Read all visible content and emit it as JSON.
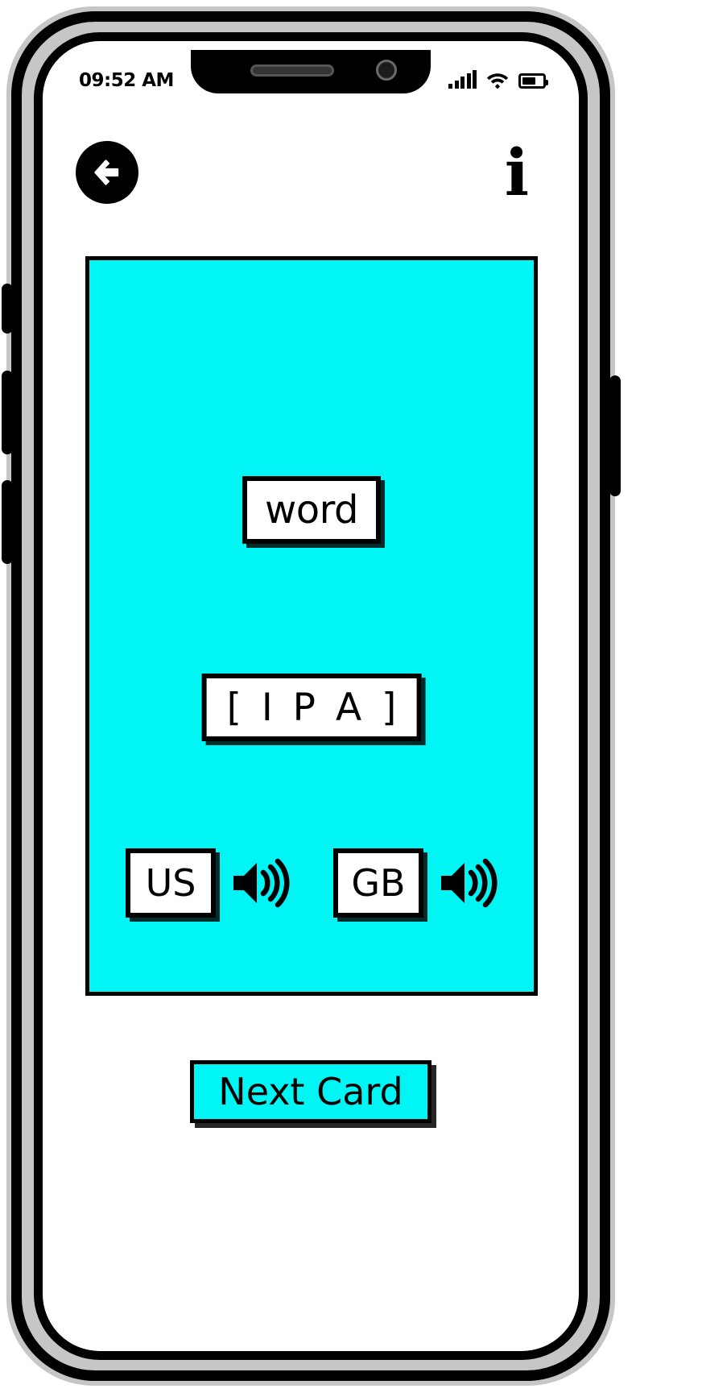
{
  "device": {
    "frame_color": "#c6c6c6",
    "outline_color": "#000000",
    "screen_background": "#ffffff",
    "side_buttons": [
      "silent-switch",
      "volume-up",
      "volume-down",
      "power"
    ]
  },
  "status_bar": {
    "time": "09:52 AM",
    "signal_icon": "cellular-signal-icon",
    "signal_bars_filled": 5,
    "wifi_icon": "wifi-icon",
    "battery_icon": "battery-icon",
    "battery_level_percent": 66
  },
  "app_bar": {
    "back_button": {
      "icon": "arrow-left-icon",
      "label": "Back"
    },
    "info_button": {
      "icon": "info-icon",
      "glyph": "i",
      "label": "Info"
    }
  },
  "flashcard": {
    "background_color": "#00f5f5",
    "border_color": "#000000",
    "word": "word",
    "ipa": "[ I P A ]",
    "audio_options": [
      {
        "locale": "US",
        "speaker_icon": "speaker-volume-icon",
        "label": "Play US pronunciation"
      },
      {
        "locale": "GB",
        "speaker_icon": "speaker-volume-icon",
        "label": "Play GB pronunciation"
      }
    ]
  },
  "actions": {
    "next_card_label": "Next Card"
  },
  "colors": {
    "accent": "#00f5f5",
    "ink": "#000000",
    "paper": "#ffffff",
    "shell": "#c6c6c6"
  }
}
